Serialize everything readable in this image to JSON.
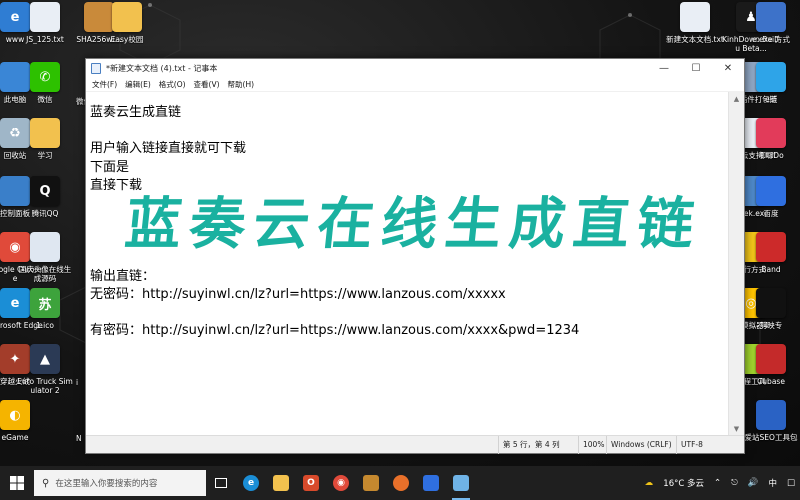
{
  "desktop": {
    "left_icons": [
      {
        "label": "www",
        "icon": "browser-icon",
        "color": "#2f7dd3",
        "glyph": "e"
      },
      {
        "label": "JS_125.txt",
        "icon": "text-file-icon",
        "color": "#e9eef5",
        "glyph": ""
      },
      {
        "label": "SHA256wi...",
        "icon": "archive-icon",
        "color": "#c98a3a",
        "glyph": ""
      },
      {
        "label": "Easy校园",
        "icon": "folder-icon",
        "color": "#f2c14e",
        "glyph": ""
      },
      {
        "label": "此电脑",
        "icon": "computer-icon",
        "color": "#3a86d6",
        "glyph": ""
      },
      {
        "label": "微信",
        "icon": "wechat-icon",
        "color": "#2dc100",
        "glyph": "✆"
      },
      {
        "label": "回收站",
        "icon": "recycle-bin-icon",
        "color": "#9fb6c8",
        "glyph": "♻"
      },
      {
        "label": "学习",
        "icon": "folder-icon",
        "color": "#f2c14e",
        "glyph": ""
      },
      {
        "label": "控制面板",
        "icon": "control-panel-icon",
        "color": "#3a7fc9",
        "glyph": ""
      },
      {
        "label": "腾讯QQ",
        "icon": "qq-icon",
        "color": "#111111",
        "glyph": "Q"
      },
      {
        "label": "Google Chrome",
        "icon": "chrome-icon",
        "color": "#e04a3a",
        "glyph": "◉"
      },
      {
        "label": "国庆头像在线生成源码",
        "icon": "document-icon",
        "color": "#dfe7f1",
        "glyph": ""
      },
      {
        "label": "Microsoft Edge",
        "icon": "edge-icon",
        "color": "#1b8ed6",
        "glyph": "e"
      },
      {
        "label": "1.ico",
        "icon": "image-icon",
        "color": "#3da33c",
        "glyph": "苏"
      },
      {
        "label": "穿越火线",
        "icon": "game-icon",
        "color": "#a33d2a",
        "glyph": "✦"
      },
      {
        "label": "Euro Truck Simulator 2",
        "icon": "truck-icon",
        "color": "#2b3a55",
        "glyph": "▲"
      },
      {
        "label": "eGame",
        "icon": "game-icon",
        "color": "#f5b400",
        "glyph": "◐"
      }
    ],
    "partial_left": [
      {
        "label": "微信",
        "top": 0
      },
      {
        "label": "i",
        "top": 0
      },
      {
        "label": "N",
        "top": 0
      }
    ],
    "right_icons": [
      {
        "label": "新建文本文档.txt",
        "icon": "text-file-icon",
        "color": "#e9eef5",
        "glyph": ""
      },
      {
        "label": "KinhDown BaiDu Beta...",
        "icon": "app-icon",
        "color": "#1a1a1a",
        "glyph": "♟"
      },
      {
        "label": "e.exe 方式",
        "icon": "app-icon",
        "color": "#3d72c9",
        "glyph": ""
      },
      {
        "label": "刷课插件打包版",
        "icon": "archive-icon",
        "color": "#8fa6c3",
        "glyph": ""
      },
      {
        "label": "e链",
        "icon": "app-icon",
        "color": "#2ea4e8",
        "glyph": ""
      },
      {
        "label": "百度云支持.txt",
        "icon": "text-file-icon",
        "color": "#e9eef5",
        "glyph": ""
      },
      {
        "label": "唧唧Do",
        "icon": "app-icon",
        "color": "#e23b5a",
        "glyph": ""
      },
      {
        "label": "Geek.exe",
        "icon": "app-icon",
        "color": "#4e88c7",
        "glyph": ""
      },
      {
        "label": "百度",
        "icon": "app-icon",
        "color": "#2f6fe0",
        "glyph": ""
      },
      {
        "label": "远行方式",
        "icon": "app-icon",
        "color": "#f0c419",
        "glyph": ""
      },
      {
        "label": "Band",
        "icon": "app-icon",
        "color": "#cc2a2a",
        "glyph": ""
      },
      {
        "label": "手模拟器4",
        "icon": "app-icon",
        "color": "#ffc400",
        "glyph": "◎"
      },
      {
        "label": "剪映专",
        "icon": "app-icon",
        "color": "#111111",
        "glyph": ""
      },
      {
        "label": "远程工具",
        "icon": "app-icon",
        "color": "#9fd22d",
        "glyph": ""
      },
      {
        "label": "Cubase",
        "icon": "app-icon",
        "color": "#c42a2a",
        "glyph": ""
      },
      {
        "label": "爱站SEO工具包",
        "icon": "app-icon",
        "color": "#2a62c4",
        "glyph": ""
      }
    ]
  },
  "notepad": {
    "title": "*新建文本文档 (4).txt - 记事本",
    "menu": [
      "文件(F)",
      "编辑(E)",
      "格式(O)",
      "查看(V)",
      "帮助(H)"
    ],
    "lines": [
      "蓝奏云生成直链",
      "",
      "用户输入链接直接就可下载",
      "下面是",
      "直接下载",
      "",
      "",
      "",
      "",
      "输出直链：",
      "无密码：http://suyinwl.cn/lz?url=https://www.lanzous.com/xxxxx",
      "",
      "有密码：http://suyinwl.cn/lz?url=https://www.lanzous.com/xxxx&pwd=1234"
    ],
    "status": {
      "position": "第 5 行，第 4 列",
      "zoom": "100%",
      "line_ending": "Windows (CRLF)",
      "encoding": "UTF-8"
    }
  },
  "banner": {
    "text": "蓝奏云在线生成直链",
    "color": "#1ab1a0"
  },
  "taskbar": {
    "search_placeholder": "在这里输入你要搜索的内容",
    "weather": "16°C 多云",
    "ime": "中"
  }
}
